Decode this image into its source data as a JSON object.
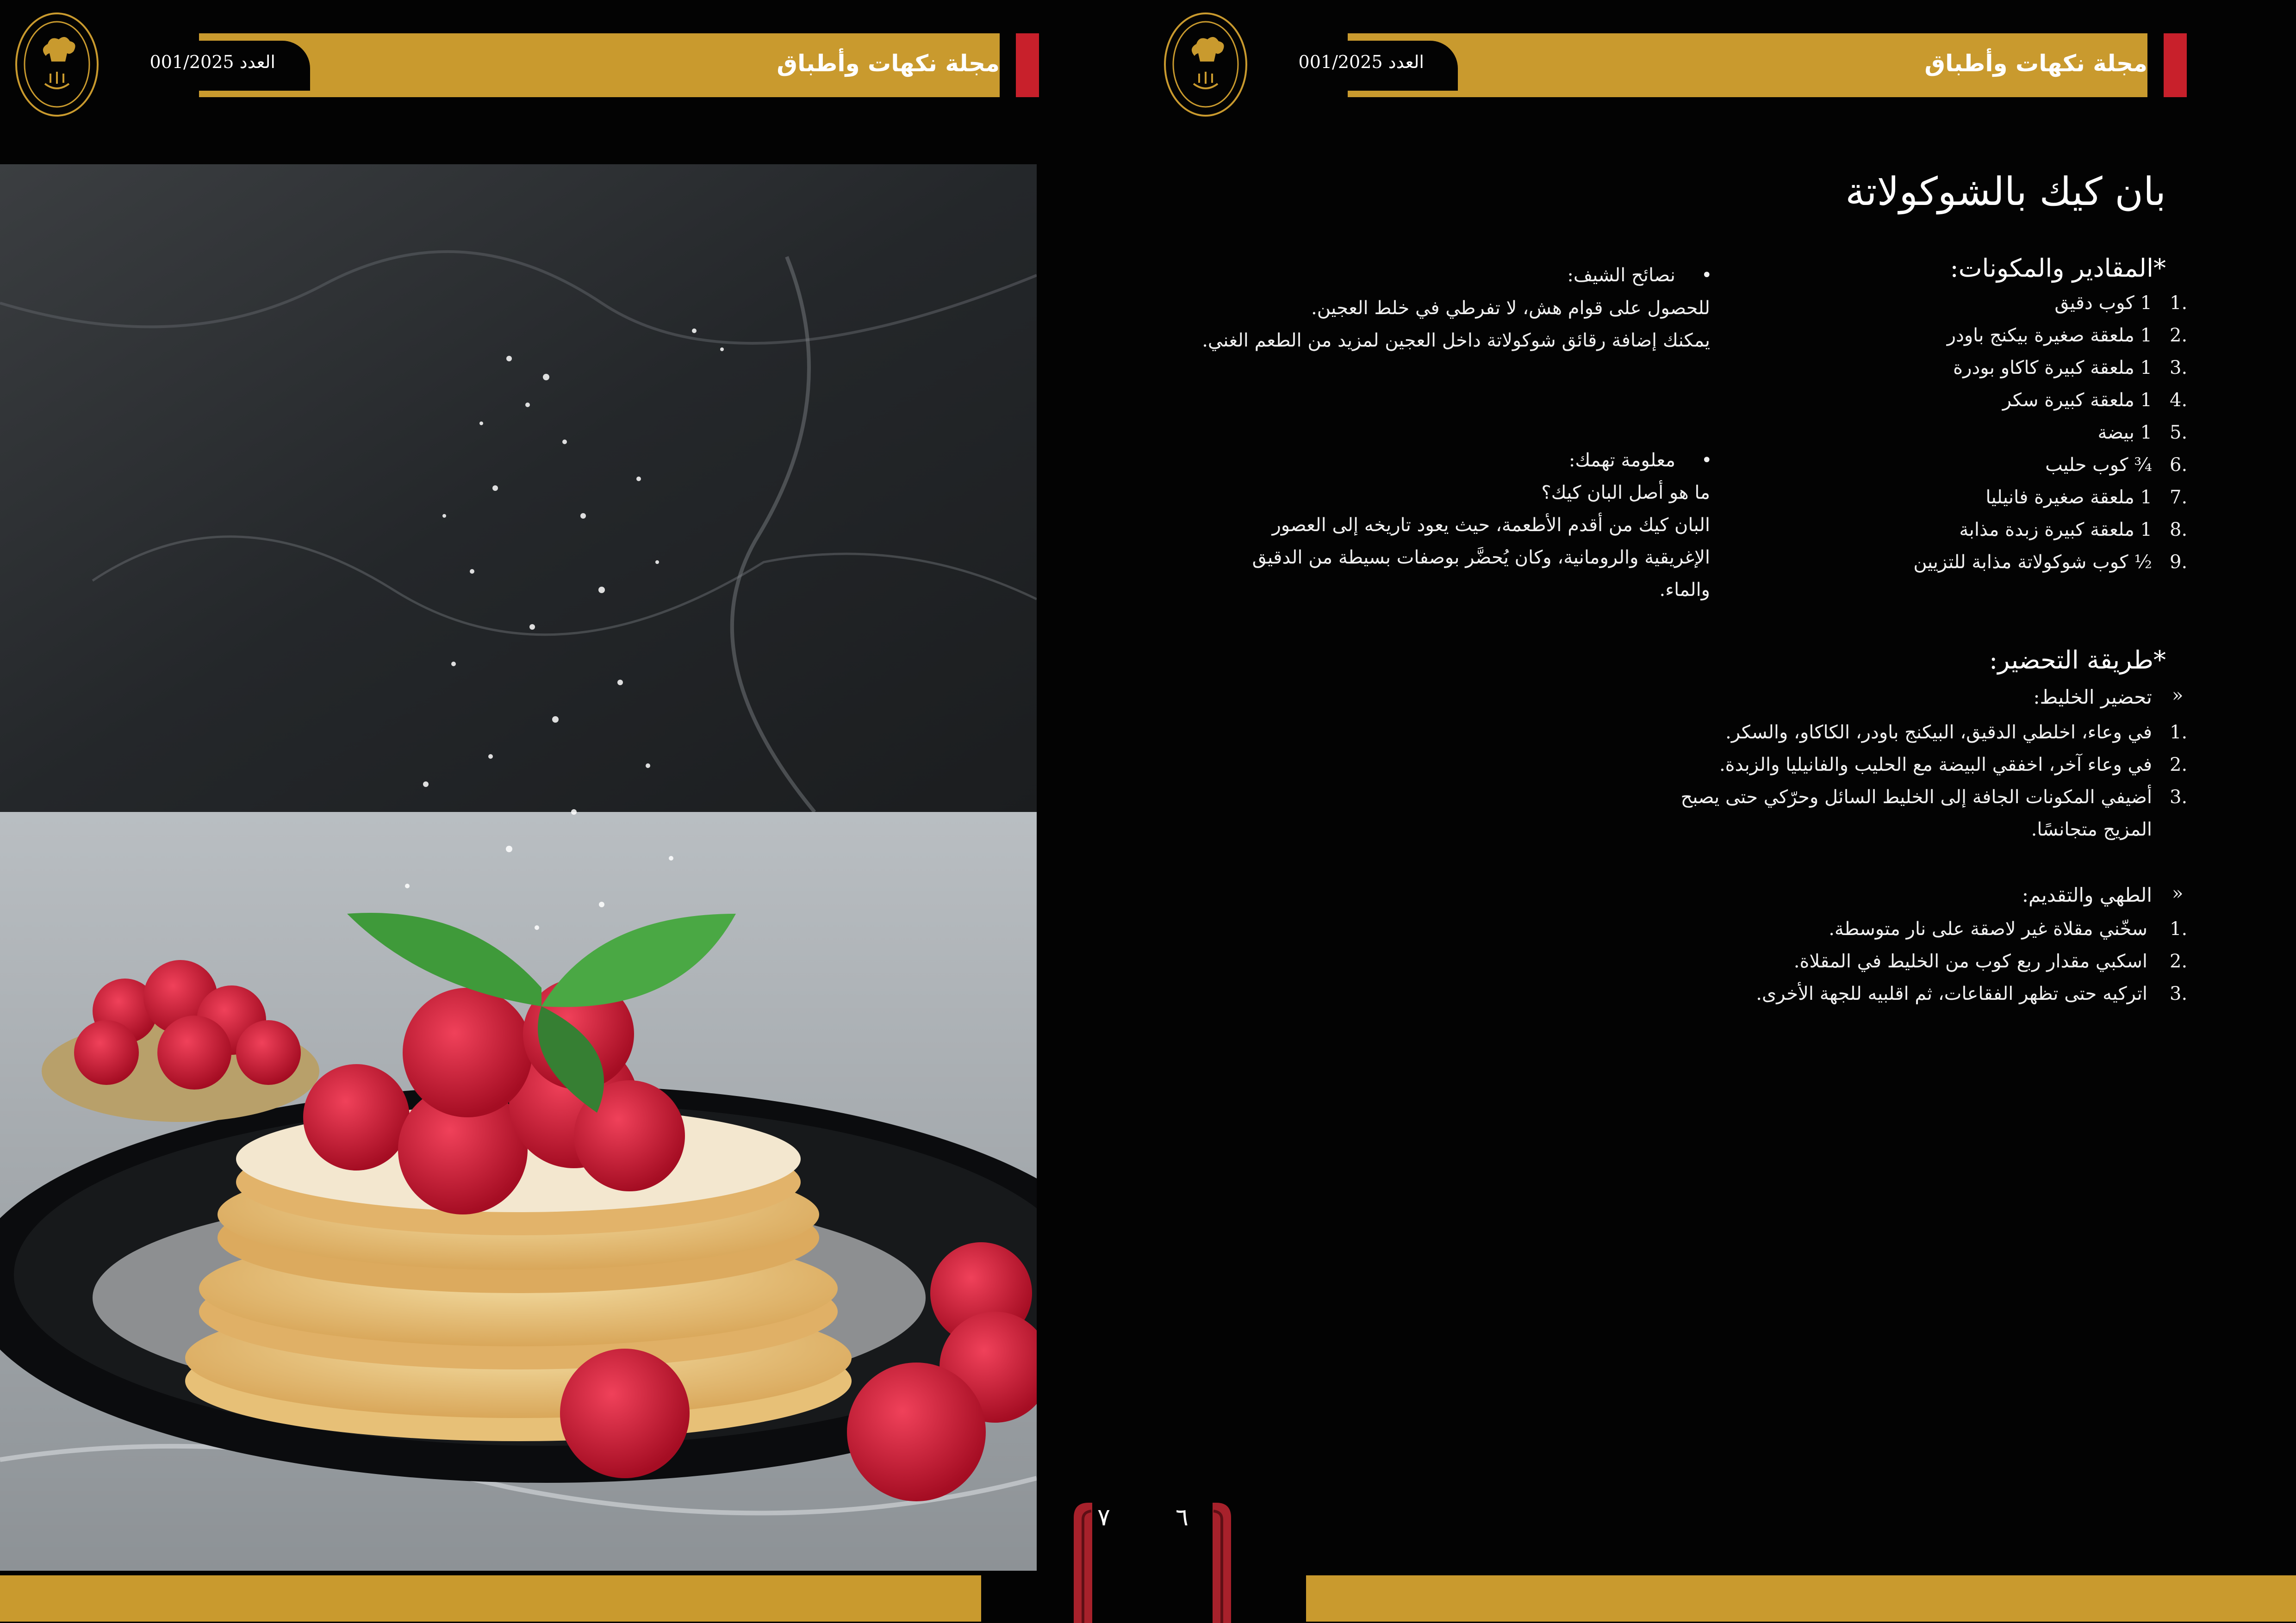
{
  "header": {
    "magazine_title": "مجلة نكهات وأطباق",
    "issue": "العدد 001/2025"
  },
  "colors": {
    "gold": "#c99a2e",
    "red": "#c8202b",
    "black": "#030303"
  },
  "image": {
    "description_icon": "pancake-photo"
  },
  "recipe": {
    "title": "بان كيك بالشوكولاتة",
    "ingredients_heading": "*المقادير والمكونات:",
    "ingredients": [
      "1 كوب دقيق",
      "1 ملعقة صغيرة بيكنج باودر",
      "1 ملعقة كبيرة كاكاو بودرة",
      "1 ملعقة كبيرة سكر",
      "1 بيضة",
      "¾ كوب حليب",
      "1 ملعقة صغيرة فانيليا",
      "1 ملعقة كبيرة زبدة مذابة",
      "½ كوب شوكولاتة مذابة للتزيين"
    ],
    "method_heading": "*طريقة التحضير:",
    "mix_heading": "تحضير الخليط:",
    "mix_steps": [
      "في وعاء، اخلطي الدقيق، البيكنج باودر، الكاكاو، والسكر.",
      "في وعاء آخر، اخفقي البيضة مع الحليب والفانيليا والزبدة.",
      "أضيفي المكونات الجافة إلى الخليط السائل وحرّكي حتى يصبح",
      "المزيج متجانسًا."
    ],
    "cook_heading": "الطهي والتقديم:",
    "cook_steps": [
      "سخّني مقلاة غير لاصقة على نار متوسطة.",
      "اسكبي مقدار ربع كوب من الخليط في المقلاة.",
      "اتركيه حتى تظهر الفقاعات، ثم اقلبيه للجهة الأخرى."
    ],
    "numbers": [
      "1.",
      "2.",
      "3.",
      "4.",
      "5.",
      "6.",
      "7.",
      "8.",
      "9."
    ],
    "arrow": "»"
  },
  "tips": {
    "bullet": "•",
    "chef_heading": "نصائح الشيف:",
    "chef_lines": [
      "للحصول على قوام هش، لا تفرطي في خلط العجين.",
      "يمكنك إضافة رقائق شوكولاتة داخل العجين لمزيد من الطعم الغني."
    ],
    "info_heading": "معلومة تهمك:",
    "info_lines": [
      "ما هو أصل البان كيك؟",
      "البان كيك من أقدم الأطعمة، حيث يعود تاريخه إلى العصور",
      "الإغريقية والرومانية، وكان يُحضَّر بوصفات بسيطة من الدقيق",
      "والماء."
    ]
  },
  "pages": {
    "left": "٧",
    "right": "٦"
  }
}
